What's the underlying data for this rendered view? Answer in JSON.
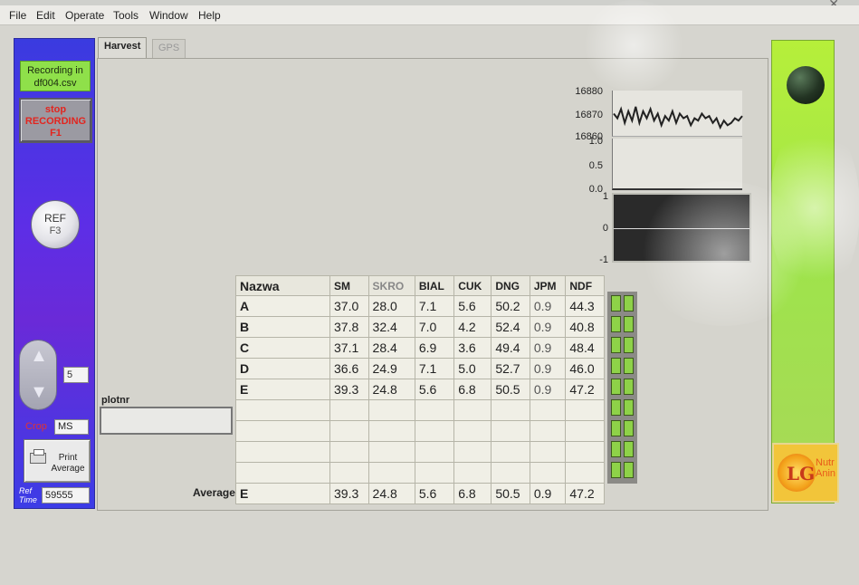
{
  "menubar": {
    "items": [
      "File",
      "Edit",
      "Operate",
      "Tools",
      "Window",
      "Help"
    ]
  },
  "left_panel": {
    "recording_status": "Recording in df004.csv",
    "stop_button": {
      "line1": "stop",
      "line2": "RECORDING",
      "line3": "F1"
    },
    "ref_button": {
      "label": "REF",
      "key": "F3"
    },
    "stepper_value": "5",
    "crop_label": "Crop",
    "crop_value": "MS",
    "print_button": {
      "line1": "Print",
      "line2": "Average"
    },
    "ref_time_label_1": "Ref",
    "ref_time_label_2": "Time",
    "ref_time_value": "59555"
  },
  "tabs": [
    {
      "label": "Harvest",
      "active": true
    },
    {
      "label": "GPS",
      "active": false
    }
  ],
  "charts": {
    "chart1": {
      "y_ticks": [
        "16880",
        "16870",
        "16860"
      ]
    },
    "chart2": {
      "y_ticks": [
        "1.0",
        "0.5",
        "0.0"
      ]
    },
    "chart3": {
      "y_ticks": [
        "1",
        "0",
        "-1"
      ]
    }
  },
  "chart_data": [
    {
      "type": "line",
      "ylim": [
        16860,
        16880
      ],
      "values": [
        16870,
        16868,
        16872,
        16866,
        16871,
        16867,
        16873,
        16866,
        16871,
        16868,
        16872,
        16867,
        16870,
        16865,
        16869,
        16867,
        16871,
        16866,
        16870,
        16868,
        16869,
        16865,
        16868,
        16867,
        16870,
        16868,
        16869,
        16866,
        16868,
        16864,
        16867,
        16865,
        16866,
        16868,
        16867,
        16869
      ]
    },
    {
      "type": "line",
      "ylim": [
        0,
        1
      ],
      "values": [
        0,
        0
      ]
    },
    {
      "type": "line",
      "ylim": [
        -1,
        1
      ],
      "values": [
        0,
        0
      ]
    }
  ],
  "plotnr": {
    "label": "plotnr",
    "value": ""
  },
  "table": {
    "headers": [
      "Nazwa",
      "SM",
      "SKRO",
      "BIAL",
      "CUK",
      "DNG",
      "JPM",
      "NDF"
    ],
    "rows": [
      [
        "A",
        "37.0",
        "28.0",
        "7.1",
        "5.6",
        "50.2",
        "0.9",
        "44.3"
      ],
      [
        "B",
        "37.8",
        "32.4",
        "7.0",
        "4.2",
        "52.4",
        "0.9",
        "40.8"
      ],
      [
        "C",
        "37.1",
        "28.4",
        "6.9",
        "3.6",
        "49.4",
        "0.9",
        "48.4"
      ],
      [
        "D",
        "36.6",
        "24.9",
        "7.1",
        "5.0",
        "52.7",
        "0.9",
        "46.0"
      ],
      [
        "E",
        "39.3",
        "24.8",
        "5.6",
        "6.8",
        "50.5",
        "0.9",
        "47.2"
      ],
      [
        "",
        "",
        "",
        "",
        "",
        "",
        "",
        ""
      ],
      [
        "",
        "",
        "",
        "",
        "",
        "",
        "",
        ""
      ],
      [
        "",
        "",
        "",
        "",
        "",
        "",
        "",
        ""
      ],
      [
        "",
        "",
        "",
        "",
        "",
        "",
        "",
        ""
      ]
    ],
    "average_label": "Average",
    "average_row": [
      "E",
      "39.3",
      "24.8",
      "5.6",
      "6.8",
      "50.5",
      "0.9",
      "47.2"
    ]
  },
  "logo": {
    "text": "LG",
    "sub_1": "Nutr",
    "sub_2": "Anin"
  },
  "colors": {
    "left_panel": "#5d2ee6",
    "status_green": "#8fe04a",
    "stop_red": "#e2251f",
    "right_panel": "#b6ef3a"
  }
}
